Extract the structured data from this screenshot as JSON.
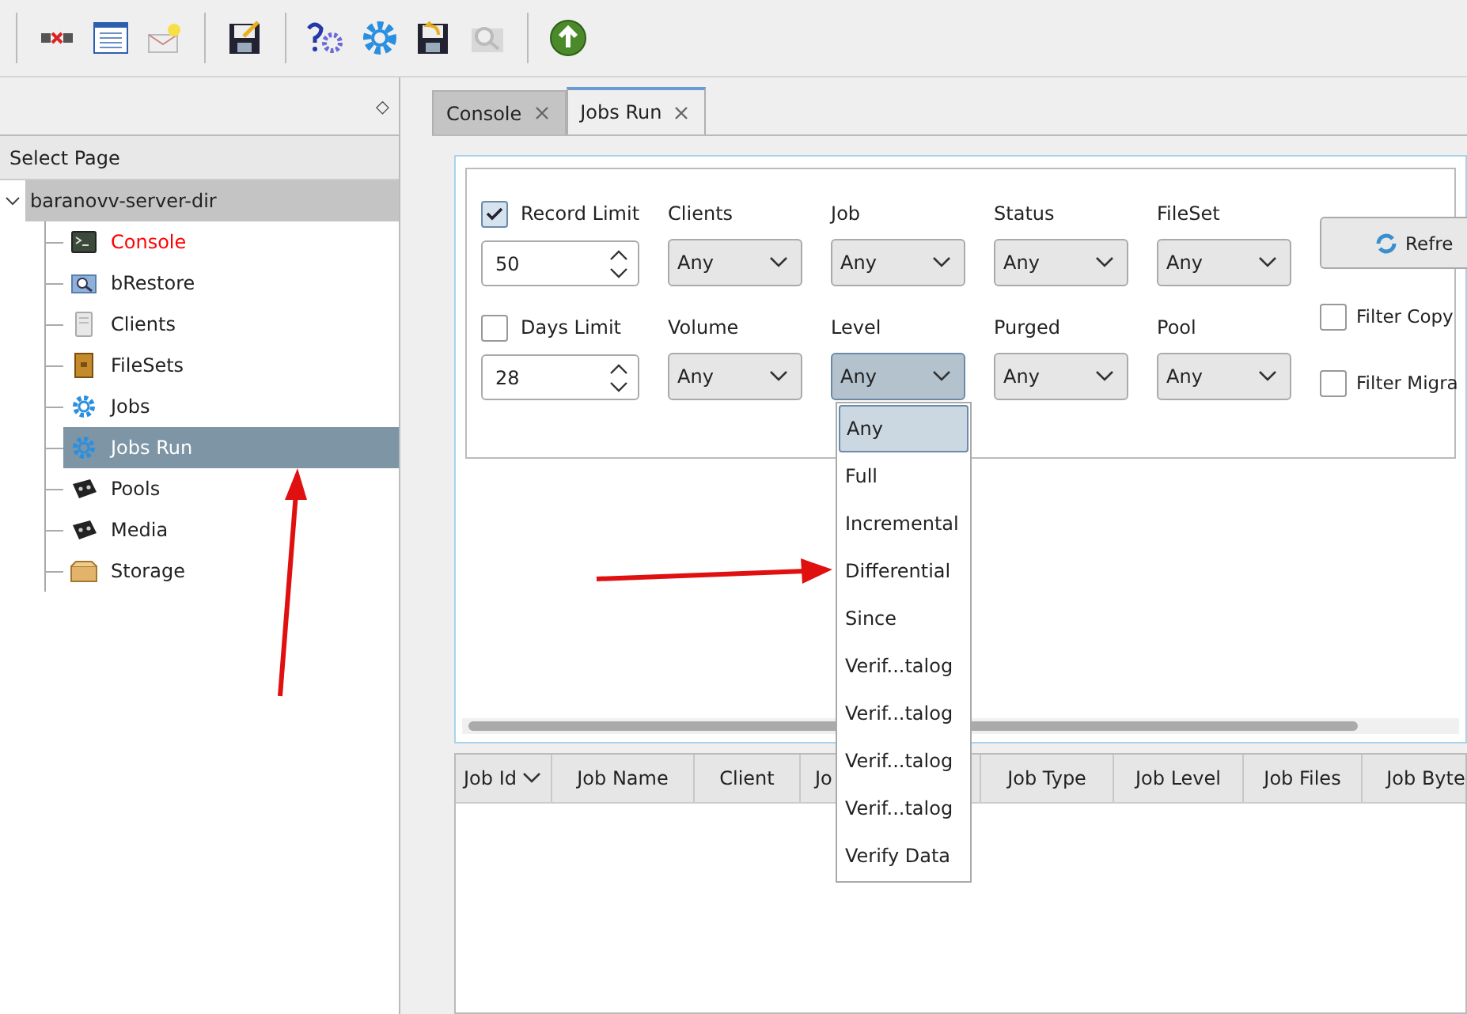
{
  "left_panel": {
    "pin": "◇",
    "header": "Select Page",
    "tree": {
      "label": "baranovv-server-dir",
      "expanded": true,
      "children": [
        {
          "label": "Console",
          "kind": "terminal",
          "alert": true,
          "selected": false
        },
        {
          "label": "bRestore",
          "kind": "restore",
          "alert": false,
          "selected": false
        },
        {
          "label": "Clients",
          "kind": "client",
          "alert": false,
          "selected": false
        },
        {
          "label": "FileSets",
          "kind": "fileset",
          "alert": false,
          "selected": false
        },
        {
          "label": "Jobs",
          "kind": "gear",
          "alert": false,
          "selected": false
        },
        {
          "label": "Jobs Run",
          "kind": "gear",
          "alert": false,
          "selected": true
        },
        {
          "label": "Pools",
          "kind": "tape",
          "alert": false,
          "selected": false
        },
        {
          "label": "Media",
          "kind": "tape",
          "alert": false,
          "selected": false
        },
        {
          "label": "Storage",
          "kind": "box",
          "alert": false,
          "selected": false
        }
      ]
    }
  },
  "tabs": [
    {
      "label": "Console",
      "selected": false
    },
    {
      "label": "Jobs Run",
      "selected": true
    }
  ],
  "filters": {
    "limits": [
      {
        "label": "Record Limit",
        "checked": true,
        "value": "50"
      },
      {
        "label": "Days Limit",
        "checked": false,
        "value": "28"
      }
    ],
    "combo_rows": [
      [
        {
          "label": "Clients",
          "value": "Any",
          "open": false
        },
        {
          "label": "Job",
          "value": "Any",
          "open": false
        },
        {
          "label": "Status",
          "value": "Any",
          "open": false
        },
        {
          "label": "FileSet",
          "value": "Any",
          "open": false
        }
      ],
      [
        {
          "label": "Volume",
          "value": "Any",
          "open": false
        },
        {
          "label": "Level",
          "value": "Any",
          "open": true
        },
        {
          "label": "Purged",
          "value": "Any",
          "open": false
        },
        {
          "label": "Pool",
          "value": "Any",
          "open": false
        }
      ]
    ],
    "refresh_button": "Refre",
    "options": [
      {
        "label": "Filter Copy",
        "checked": false
      },
      {
        "label": "Filter Migra",
        "checked": false
      }
    ]
  },
  "level_dropdown": [
    {
      "label": "Any",
      "selected": true
    },
    {
      "label": "Full",
      "selected": false
    },
    {
      "label": "Incremental",
      "selected": false
    },
    {
      "label": "Differential",
      "selected": false
    },
    {
      "label": "Since",
      "selected": false
    },
    {
      "label": "Verif...talog",
      "selected": false
    },
    {
      "label": "Verif...talog",
      "selected": false
    },
    {
      "label": "Verif...talog",
      "selected": false
    },
    {
      "label": "Verif...talog",
      "selected": false
    },
    {
      "label": "Verify Data",
      "selected": false
    }
  ],
  "table": {
    "sort_descending": true,
    "columns": [
      "Job Id",
      "Job Name",
      "Client",
      "Jo",
      "Job Type",
      "Job Level",
      "Job Files",
      "Job Byte"
    ]
  }
}
